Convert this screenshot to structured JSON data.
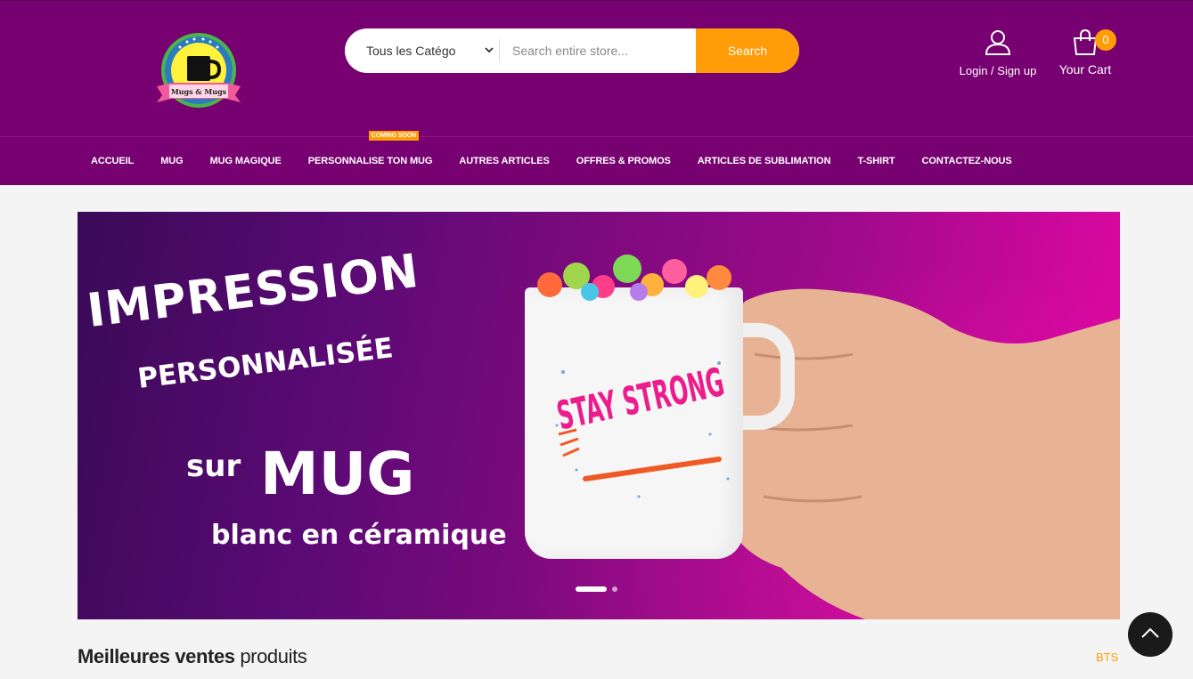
{
  "header": {
    "logo_text": "Mugs & Mugs",
    "search": {
      "category_selected": "Tous les Catégo",
      "placeholder": "Search entire store...",
      "button_label": "Search"
    },
    "account_label": "Login / Sign up",
    "cart_label": "Your Cart",
    "cart_count": "0"
  },
  "nav": {
    "items": [
      {
        "label": "ACCUEIL"
      },
      {
        "label": "MUG"
      },
      {
        "label": "MUG MAGIQUE"
      },
      {
        "label": "PERSONNALISE TON MUG",
        "badge": "COMING SOON"
      },
      {
        "label": "AUTRES ARTICLES"
      },
      {
        "label": "OFFRES & PROMOS"
      },
      {
        "label": "ARTICLES DE SUBLIMATION"
      },
      {
        "label": "T-SHIRT"
      },
      {
        "label": "CONTACTEZ-NOUS"
      }
    ]
  },
  "banner": {
    "line1": "IMPRESSION",
    "line2": "PERSONNALISÉE",
    "line3a": "sur",
    "line3b": "MUG",
    "line4": "blanc en céramique",
    "mug_text": "STAY STRONG",
    "slides_total": 2,
    "active_slide": 1
  },
  "section": {
    "title_bold": "Meilleures ventes",
    "title_light": " produits",
    "tab_label": "BTS"
  },
  "colors": {
    "brand_purple": "#770170",
    "accent_orange": "#ff9c07"
  },
  "icons": [
    "chevron-down-icon",
    "user-icon",
    "shopping-bag-icon",
    "arrow-up-icon"
  ]
}
